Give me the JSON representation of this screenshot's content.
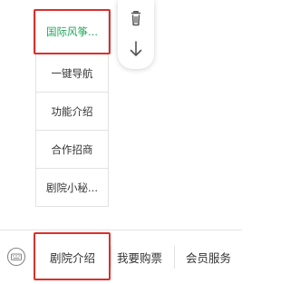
{
  "submenu": {
    "items": [
      {
        "label": "国际风筝..."
      },
      {
        "label": "一键导航"
      },
      {
        "label": "功能介绍"
      },
      {
        "label": "合作招商"
      },
      {
        "label": "剧院小秘..."
      }
    ],
    "active_color": "#21a65b"
  },
  "toolbar": {
    "delete_icon": "trash-icon",
    "move_down_icon": "arrow-down-icon"
  },
  "bottom_bar": {
    "keyboard_icon": "keyboard-icon",
    "tabs": [
      {
        "label": "剧院介绍"
      },
      {
        "label": "我要购票"
      },
      {
        "label": "会员服务"
      }
    ]
  },
  "highlight_color": "#d9302c"
}
